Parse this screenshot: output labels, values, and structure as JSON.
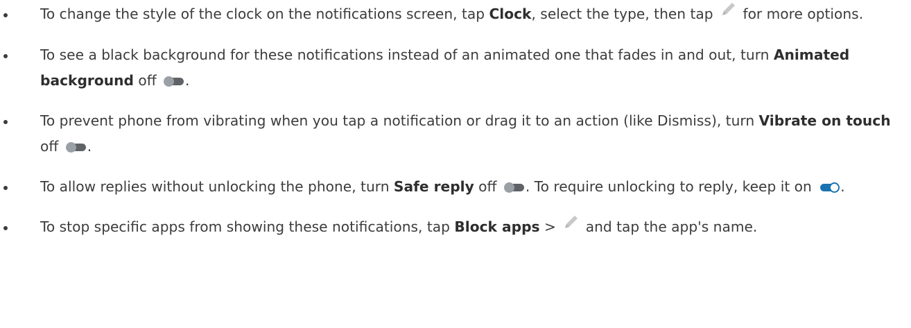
{
  "items": [
    {
      "t1": "To change the style of the clock on the notifications screen, tap ",
      "b1": "Clock",
      "t2": ", select the type, then tap ",
      "icon": "pencil-icon",
      "t3": " for more options."
    },
    {
      "t1": "To see a black background for these notifications instead of an animated one that fades in and out, turn ",
      "b1": "Animated background",
      "t2": " off ",
      "icon": "toggle-off-icon",
      "t3": "."
    },
    {
      "t1": "To prevent phone from vibrating when you tap a notification or drag it to an action (like Dismiss), turn ",
      "b1": "Vibrate on touch",
      "t2": " off ",
      "icon": "toggle-off-icon",
      "t3": "."
    },
    {
      "t1": "To allow replies without unlocking the phone, turn ",
      "b1": "Safe reply",
      "t2": " off ",
      "icon": "toggle-off-icon",
      "t3": ". To require unlocking to reply, keep it on ",
      "icon2": "toggle-on-icon",
      "t4": "."
    },
    {
      "t1": "To stop specific apps from showing these notifications, tap ",
      "b1": "Block apps",
      "t2": " > ",
      "icon": "pencil-icon",
      "t3": " and tap the app's name."
    }
  ],
  "colors": {
    "text": "#3c3c3c",
    "toggle_off_track": "#5f6368",
    "toggle_off_knob": "#9aa0a6",
    "toggle_on": "#1a73b0",
    "pencil": "#c8c8c8"
  }
}
